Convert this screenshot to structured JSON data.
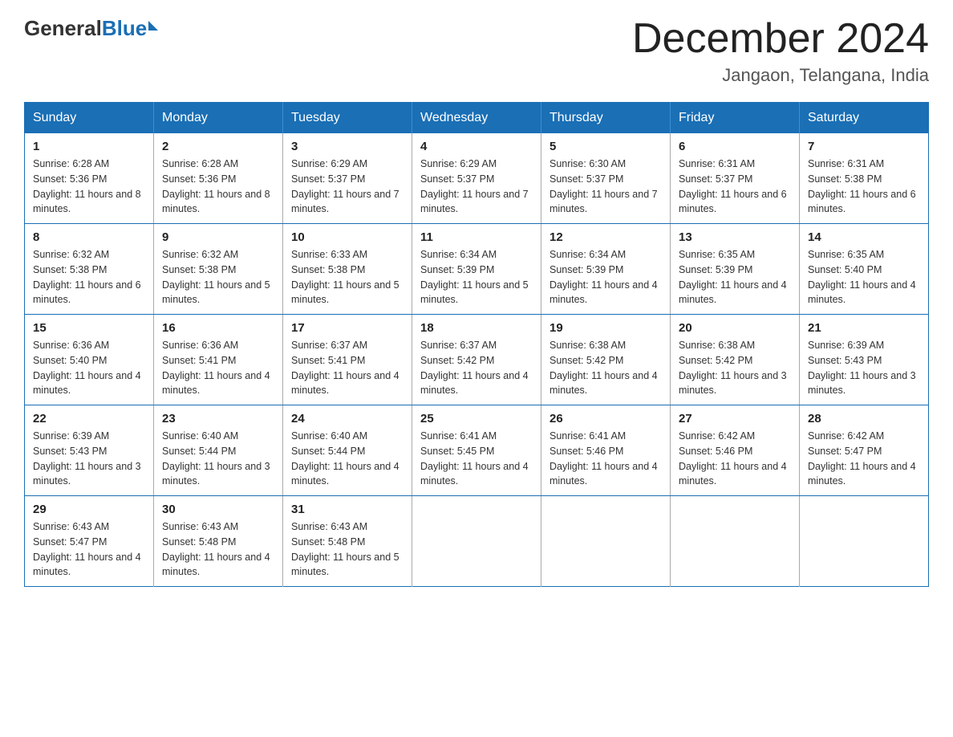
{
  "header": {
    "logo": {
      "general": "General",
      "blue": "Blue"
    },
    "title": "December 2024",
    "location": "Jangaon, Telangana, India"
  },
  "days_of_week": [
    "Sunday",
    "Monday",
    "Tuesday",
    "Wednesday",
    "Thursday",
    "Friday",
    "Saturday"
  ],
  "weeks": [
    [
      {
        "day": "1",
        "sunrise": "6:28 AM",
        "sunset": "5:36 PM",
        "daylight": "11 hours and 8 minutes."
      },
      {
        "day": "2",
        "sunrise": "6:28 AM",
        "sunset": "5:36 PM",
        "daylight": "11 hours and 8 minutes."
      },
      {
        "day": "3",
        "sunrise": "6:29 AM",
        "sunset": "5:37 PM",
        "daylight": "11 hours and 7 minutes."
      },
      {
        "day": "4",
        "sunrise": "6:29 AM",
        "sunset": "5:37 PM",
        "daylight": "11 hours and 7 minutes."
      },
      {
        "day": "5",
        "sunrise": "6:30 AM",
        "sunset": "5:37 PM",
        "daylight": "11 hours and 7 minutes."
      },
      {
        "day": "6",
        "sunrise": "6:31 AM",
        "sunset": "5:37 PM",
        "daylight": "11 hours and 6 minutes."
      },
      {
        "day": "7",
        "sunrise": "6:31 AM",
        "sunset": "5:38 PM",
        "daylight": "11 hours and 6 minutes."
      }
    ],
    [
      {
        "day": "8",
        "sunrise": "6:32 AM",
        "sunset": "5:38 PM",
        "daylight": "11 hours and 6 minutes."
      },
      {
        "day": "9",
        "sunrise": "6:32 AM",
        "sunset": "5:38 PM",
        "daylight": "11 hours and 5 minutes."
      },
      {
        "day": "10",
        "sunrise": "6:33 AM",
        "sunset": "5:38 PM",
        "daylight": "11 hours and 5 minutes."
      },
      {
        "day": "11",
        "sunrise": "6:34 AM",
        "sunset": "5:39 PM",
        "daylight": "11 hours and 5 minutes."
      },
      {
        "day": "12",
        "sunrise": "6:34 AM",
        "sunset": "5:39 PM",
        "daylight": "11 hours and 4 minutes."
      },
      {
        "day": "13",
        "sunrise": "6:35 AM",
        "sunset": "5:39 PM",
        "daylight": "11 hours and 4 minutes."
      },
      {
        "day": "14",
        "sunrise": "6:35 AM",
        "sunset": "5:40 PM",
        "daylight": "11 hours and 4 minutes."
      }
    ],
    [
      {
        "day": "15",
        "sunrise": "6:36 AM",
        "sunset": "5:40 PM",
        "daylight": "11 hours and 4 minutes."
      },
      {
        "day": "16",
        "sunrise": "6:36 AM",
        "sunset": "5:41 PM",
        "daylight": "11 hours and 4 minutes."
      },
      {
        "day": "17",
        "sunrise": "6:37 AM",
        "sunset": "5:41 PM",
        "daylight": "11 hours and 4 minutes."
      },
      {
        "day": "18",
        "sunrise": "6:37 AM",
        "sunset": "5:42 PM",
        "daylight": "11 hours and 4 minutes."
      },
      {
        "day": "19",
        "sunrise": "6:38 AM",
        "sunset": "5:42 PM",
        "daylight": "11 hours and 4 minutes."
      },
      {
        "day": "20",
        "sunrise": "6:38 AM",
        "sunset": "5:42 PM",
        "daylight": "11 hours and 3 minutes."
      },
      {
        "day": "21",
        "sunrise": "6:39 AM",
        "sunset": "5:43 PM",
        "daylight": "11 hours and 3 minutes."
      }
    ],
    [
      {
        "day": "22",
        "sunrise": "6:39 AM",
        "sunset": "5:43 PM",
        "daylight": "11 hours and 3 minutes."
      },
      {
        "day": "23",
        "sunrise": "6:40 AM",
        "sunset": "5:44 PM",
        "daylight": "11 hours and 3 minutes."
      },
      {
        "day": "24",
        "sunrise": "6:40 AM",
        "sunset": "5:44 PM",
        "daylight": "11 hours and 4 minutes."
      },
      {
        "day": "25",
        "sunrise": "6:41 AM",
        "sunset": "5:45 PM",
        "daylight": "11 hours and 4 minutes."
      },
      {
        "day": "26",
        "sunrise": "6:41 AM",
        "sunset": "5:46 PM",
        "daylight": "11 hours and 4 minutes."
      },
      {
        "day": "27",
        "sunrise": "6:42 AM",
        "sunset": "5:46 PM",
        "daylight": "11 hours and 4 minutes."
      },
      {
        "day": "28",
        "sunrise": "6:42 AM",
        "sunset": "5:47 PM",
        "daylight": "11 hours and 4 minutes."
      }
    ],
    [
      {
        "day": "29",
        "sunrise": "6:43 AM",
        "sunset": "5:47 PM",
        "daylight": "11 hours and 4 minutes."
      },
      {
        "day": "30",
        "sunrise": "6:43 AM",
        "sunset": "5:48 PM",
        "daylight": "11 hours and 4 minutes."
      },
      {
        "day": "31",
        "sunrise": "6:43 AM",
        "sunset": "5:48 PM",
        "daylight": "11 hours and 5 minutes."
      },
      null,
      null,
      null,
      null
    ]
  ],
  "labels": {
    "sunrise": "Sunrise:",
    "sunset": "Sunset:",
    "daylight": "Daylight:"
  }
}
